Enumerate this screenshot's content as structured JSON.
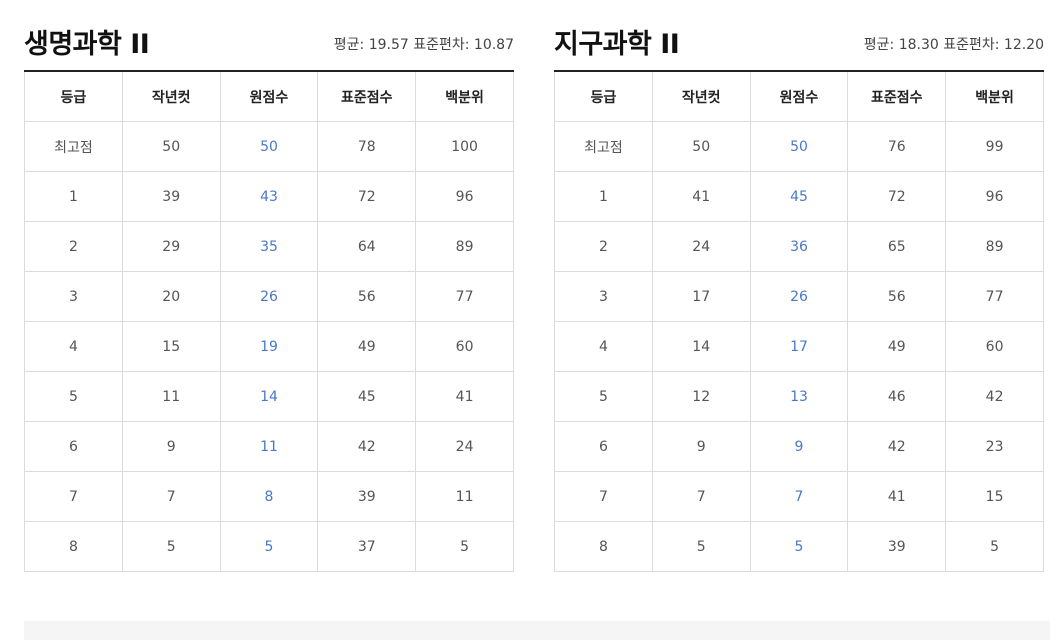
{
  "columns": [
    "등급",
    "작년컷",
    "원점수",
    "표준점수",
    "백분위"
  ],
  "panels": [
    {
      "title": "생명과학 II",
      "stats": "평균: 19.57 표준편차: 10.87",
      "rows": [
        [
          "최고점",
          "50",
          "50",
          "78",
          "100"
        ],
        [
          "1",
          "39",
          "43",
          "72",
          "96"
        ],
        [
          "2",
          "29",
          "35",
          "64",
          "89"
        ],
        [
          "3",
          "20",
          "26",
          "56",
          "77"
        ],
        [
          "4",
          "15",
          "19",
          "49",
          "60"
        ],
        [
          "5",
          "11",
          "14",
          "45",
          "41"
        ],
        [
          "6",
          "9",
          "11",
          "42",
          "24"
        ],
        [
          "7",
          "7",
          "8",
          "39",
          "11"
        ],
        [
          "8",
          "5",
          "5",
          "37",
          "5"
        ]
      ]
    },
    {
      "title": "지구과학 II",
      "stats": "평균: 18.30 표준편차: 12.20",
      "rows": [
        [
          "최고점",
          "50",
          "50",
          "76",
          "99"
        ],
        [
          "1",
          "41",
          "45",
          "72",
          "96"
        ],
        [
          "2",
          "24",
          "36",
          "65",
          "89"
        ],
        [
          "3",
          "17",
          "26",
          "56",
          "77"
        ],
        [
          "4",
          "14",
          "17",
          "49",
          "60"
        ],
        [
          "5",
          "12",
          "13",
          "46",
          "42"
        ],
        [
          "6",
          "9",
          "9",
          "42",
          "23"
        ],
        [
          "7",
          "7",
          "7",
          "41",
          "15"
        ],
        [
          "8",
          "5",
          "5",
          "39",
          "5"
        ]
      ]
    }
  ],
  "colors": {
    "raw_score_text": "#4a78c8",
    "header_rule": "#222222",
    "grid_line": "#dcdcdc"
  }
}
